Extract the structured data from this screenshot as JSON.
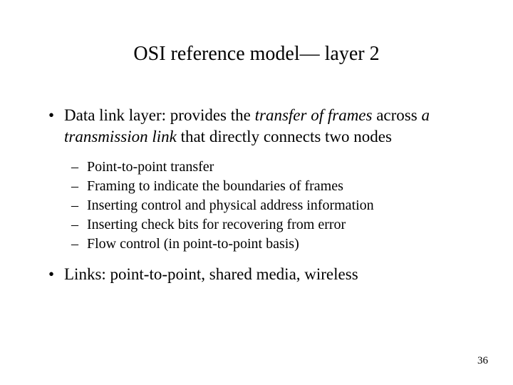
{
  "title": "OSI reference model— layer 2",
  "main_bullet": {
    "plain_1": "Data link layer: provides the ",
    "italic_1": "transfer of frames",
    "plain_2": " across ",
    "italic_2": "a transmission link",
    "plain_3": " that directly connects two nodes"
  },
  "sub_bullets": [
    "Point-to-point transfer",
    "Framing to indicate the boundaries of frames",
    "Inserting control and physical address information",
    "Inserting check bits for recovering from error",
    "Flow control (in point-to-point basis)"
  ],
  "second_bullet": "Links: point-to-point, shared media, wireless",
  "page_number": "36"
}
